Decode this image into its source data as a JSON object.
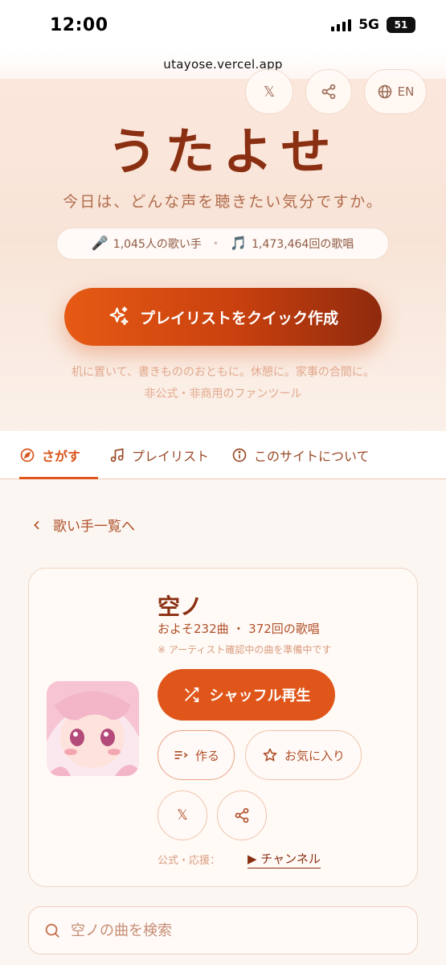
{
  "status_bar": {
    "time": "12:00",
    "network": "5G",
    "battery": "51"
  },
  "browser": {
    "url": "utayose.vercel.app"
  },
  "header": {
    "x_label": "𝕏",
    "lang_label": "EN",
    "logo": "うたよせ",
    "tagline": "今日は、どんな声を聴きたい気分ですか。",
    "stats": {
      "singers": "1,045人の歌い手",
      "songs": "1,473,464回の歌唱"
    },
    "cta": "プレイリストをクイック作成",
    "hint_line1": "机に置いて、書きもののおともに。休憩に。家事の合間に。",
    "hint_line2": "非公式・非商用のファンツール"
  },
  "tabs": [
    {
      "label": "さがす",
      "active": true
    },
    {
      "label": "プレイリスト",
      "active": false
    },
    {
      "label": "このサイトについて",
      "active": false
    }
  ],
  "back_link": "歌い手一覧へ",
  "artist": {
    "name": "空ノ",
    "meta": "およそ232曲 ・ 372回の歌唱",
    "note": "※ アーティスト確認中の曲を準備中です",
    "shuffle": "シャッフル再生",
    "make": "作る",
    "favorite": "お気に入り",
    "x_label": "𝕏",
    "official_label": "公式・応援：",
    "channel": "▶ チャンネル"
  },
  "search": {
    "placeholder": "空ノの曲を検索"
  },
  "colors": {
    "accent": "#e0561a",
    "brand_dark": "#8a2f12"
  }
}
